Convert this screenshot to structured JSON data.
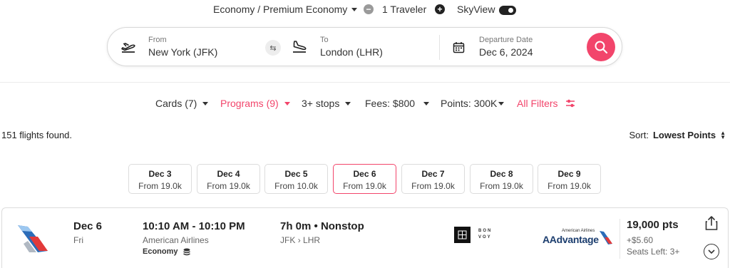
{
  "top_options": {
    "cabin": "Economy / Premium Economy",
    "travelers": "1 Traveler",
    "skyview": "SkyView"
  },
  "search": {
    "from_label": "From",
    "from_value": "New York (JFK)",
    "to_label": "To",
    "to_value": "London (LHR)",
    "date_label": "Departure Date",
    "date_value": "Dec 6, 2024"
  },
  "filters": {
    "cards": "Cards (7)",
    "programs": "Programs (9)",
    "stops": "3+ stops",
    "fees": "Fees: $800",
    "points": "Points: 300K",
    "all_filters": "All Filters"
  },
  "results": {
    "found": "151 flights found.",
    "sort_label": "Sort:",
    "sort_value": "Lowest Points"
  },
  "date_cards": [
    {
      "date": "Dec 3",
      "from": "From 19.0k"
    },
    {
      "date": "Dec 4",
      "from": "From 19.0k"
    },
    {
      "date": "Dec 5",
      "from": "From 10.0k"
    },
    {
      "date": "Dec 6",
      "from": "From 19.0k"
    },
    {
      "date": "Dec 7",
      "from": "From 19.0k"
    },
    {
      "date": "Dec 8",
      "from": "From 19.0k"
    },
    {
      "date": "Dec 9",
      "from": "From 19.0k"
    }
  ],
  "selected_date_index": 3,
  "flight": {
    "date": "Dec 6",
    "day": "Fri",
    "time": "10:10 AM - 10:10 PM",
    "airline": "American Airlines",
    "cabin": "Economy",
    "duration": "7h 0m • Nonstop",
    "origin": "JFK",
    "destination": "LHR",
    "bonvoy_line1": "BON",
    "bonvoy_line2": "VOY",
    "program_small": "American Airlines",
    "program_name": "AAdvantage",
    "points": "19,000 pts",
    "fee": "+$5.60",
    "seats": "Seats Left: 3+"
  },
  "colors": {
    "accent": "#f2456b",
    "text": "#333333",
    "border": "#dcdcdc"
  }
}
